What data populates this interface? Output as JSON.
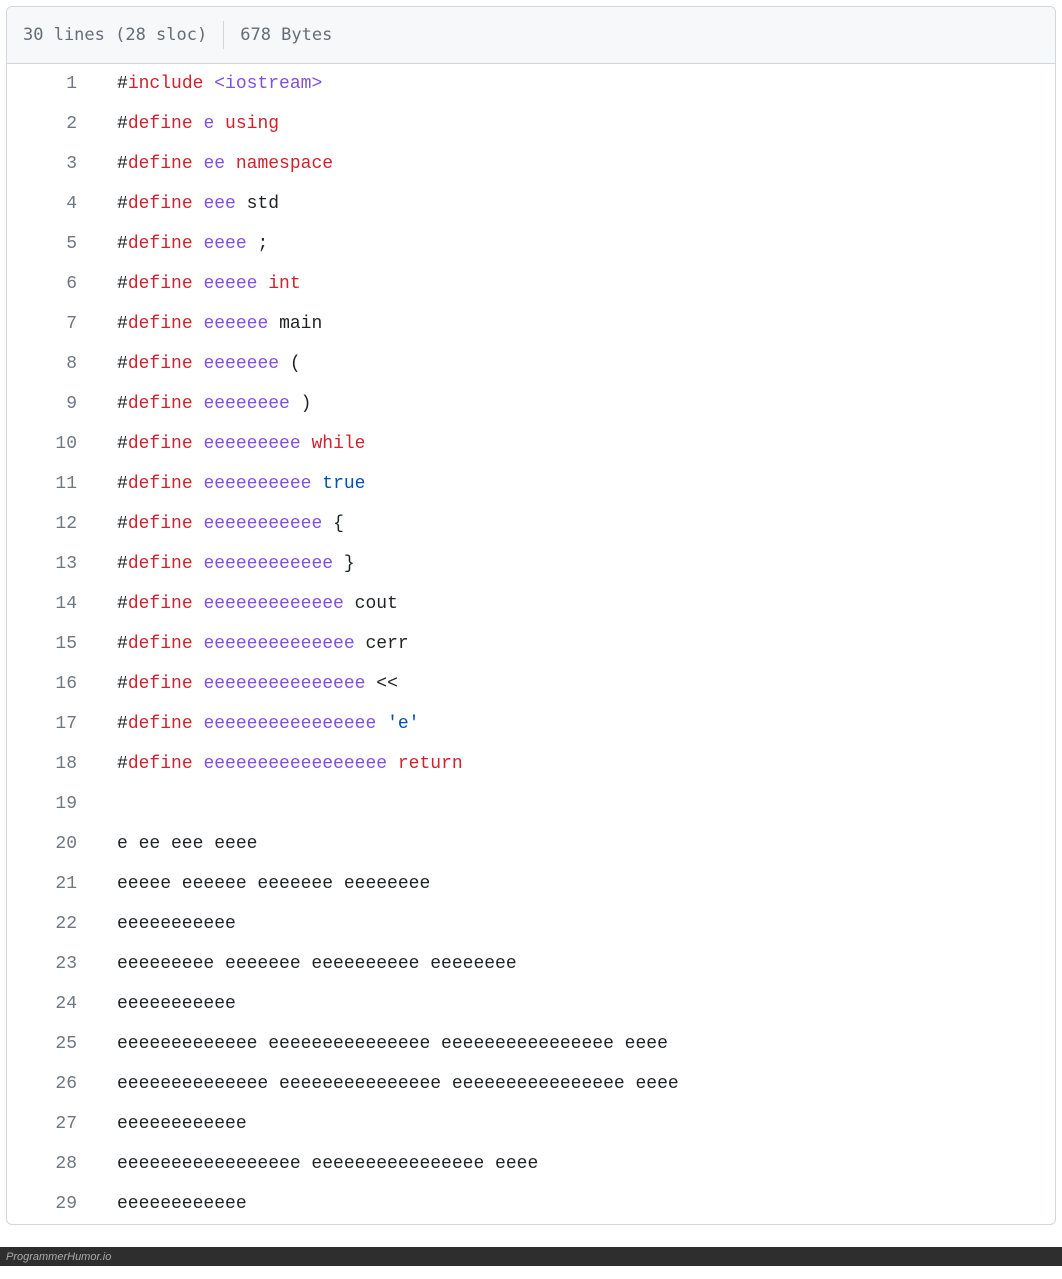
{
  "header": {
    "lines_text": "30 lines (28 sloc)",
    "size_text": "678 Bytes"
  },
  "code": {
    "lines": [
      {
        "n": 1,
        "tokens": [
          {
            "t": "#"
          },
          {
            "t": "include",
            "c": "k-red"
          },
          {
            "t": " "
          },
          {
            "t": "<iostream>",
            "c": "k-purple"
          }
        ]
      },
      {
        "n": 2,
        "tokens": [
          {
            "t": "#"
          },
          {
            "t": "define",
            "c": "k-red"
          },
          {
            "t": " "
          },
          {
            "t": "e ",
            "c": "k-purple"
          },
          {
            "t": "using",
            "c": "k-red"
          }
        ]
      },
      {
        "n": 3,
        "tokens": [
          {
            "t": "#"
          },
          {
            "t": "define",
            "c": "k-red"
          },
          {
            "t": " "
          },
          {
            "t": "ee ",
            "c": "k-purple"
          },
          {
            "t": "namespace",
            "c": "k-red"
          }
        ]
      },
      {
        "n": 4,
        "tokens": [
          {
            "t": "#"
          },
          {
            "t": "define",
            "c": "k-red"
          },
          {
            "t": " "
          },
          {
            "t": "eee ",
            "c": "k-purple"
          },
          {
            "t": "std"
          }
        ]
      },
      {
        "n": 5,
        "tokens": [
          {
            "t": "#"
          },
          {
            "t": "define",
            "c": "k-red"
          },
          {
            "t": " "
          },
          {
            "t": "eeee ",
            "c": "k-purple"
          },
          {
            "t": ";"
          }
        ]
      },
      {
        "n": 6,
        "tokens": [
          {
            "t": "#"
          },
          {
            "t": "define",
            "c": "k-red"
          },
          {
            "t": " "
          },
          {
            "t": "eeeee ",
            "c": "k-purple"
          },
          {
            "t": "int",
            "c": "k-red"
          }
        ]
      },
      {
        "n": 7,
        "tokens": [
          {
            "t": "#"
          },
          {
            "t": "define",
            "c": "k-red"
          },
          {
            "t": " "
          },
          {
            "t": "eeeeee ",
            "c": "k-purple"
          },
          {
            "t": "main"
          }
        ]
      },
      {
        "n": 8,
        "tokens": [
          {
            "t": "#"
          },
          {
            "t": "define",
            "c": "k-red"
          },
          {
            "t": " "
          },
          {
            "t": "eeeeeee ",
            "c": "k-purple"
          },
          {
            "t": "("
          }
        ]
      },
      {
        "n": 9,
        "tokens": [
          {
            "t": "#"
          },
          {
            "t": "define",
            "c": "k-red"
          },
          {
            "t": " "
          },
          {
            "t": "eeeeeeee ",
            "c": "k-purple"
          },
          {
            "t": ")"
          }
        ]
      },
      {
        "n": 10,
        "tokens": [
          {
            "t": "#"
          },
          {
            "t": "define",
            "c": "k-red"
          },
          {
            "t": " "
          },
          {
            "t": "eeeeeeeee ",
            "c": "k-purple"
          },
          {
            "t": "while",
            "c": "k-red"
          }
        ]
      },
      {
        "n": 11,
        "tokens": [
          {
            "t": "#"
          },
          {
            "t": "define",
            "c": "k-red"
          },
          {
            "t": " "
          },
          {
            "t": "eeeeeeeeee ",
            "c": "k-purple"
          },
          {
            "t": "true",
            "c": "k-blue"
          }
        ]
      },
      {
        "n": 12,
        "tokens": [
          {
            "t": "#"
          },
          {
            "t": "define",
            "c": "k-red"
          },
          {
            "t": " "
          },
          {
            "t": "eeeeeeeeeee ",
            "c": "k-purple"
          },
          {
            "t": "{"
          }
        ]
      },
      {
        "n": 13,
        "tokens": [
          {
            "t": "#"
          },
          {
            "t": "define",
            "c": "k-red"
          },
          {
            "t": " "
          },
          {
            "t": "eeeeeeeeeeee ",
            "c": "k-purple"
          },
          {
            "t": "}"
          }
        ]
      },
      {
        "n": 14,
        "tokens": [
          {
            "t": "#"
          },
          {
            "t": "define",
            "c": "k-red"
          },
          {
            "t": " "
          },
          {
            "t": "eeeeeeeeeeeee ",
            "c": "k-purple"
          },
          {
            "t": "cout"
          }
        ]
      },
      {
        "n": 15,
        "tokens": [
          {
            "t": "#"
          },
          {
            "t": "define",
            "c": "k-red"
          },
          {
            "t": " "
          },
          {
            "t": "eeeeeeeeeeeeee ",
            "c": "k-purple"
          },
          {
            "t": "cerr"
          }
        ]
      },
      {
        "n": 16,
        "tokens": [
          {
            "t": "#"
          },
          {
            "t": "define",
            "c": "k-red"
          },
          {
            "t": " "
          },
          {
            "t": "eeeeeeeeeeeeeee ",
            "c": "k-purple"
          },
          {
            "t": "<<"
          }
        ]
      },
      {
        "n": 17,
        "tokens": [
          {
            "t": "#"
          },
          {
            "t": "define",
            "c": "k-red"
          },
          {
            "t": " "
          },
          {
            "t": "eeeeeeeeeeeeeeee ",
            "c": "k-purple"
          },
          {
            "t": "'e'",
            "c": "k-blue"
          }
        ]
      },
      {
        "n": 18,
        "tokens": [
          {
            "t": "#"
          },
          {
            "t": "define",
            "c": "k-red"
          },
          {
            "t": " "
          },
          {
            "t": "eeeeeeeeeeeeeeeee ",
            "c": "k-purple"
          },
          {
            "t": "return",
            "c": "k-red"
          }
        ]
      },
      {
        "n": 19,
        "tokens": []
      },
      {
        "n": 20,
        "tokens": [
          {
            "t": "e ee eee eeee"
          }
        ]
      },
      {
        "n": 21,
        "tokens": [
          {
            "t": "eeeee eeeeee eeeeeee eeeeeeee"
          }
        ]
      },
      {
        "n": 22,
        "tokens": [
          {
            "t": "eeeeeeeeeee"
          }
        ]
      },
      {
        "n": 23,
        "tokens": [
          {
            "t": "eeeeeeeee eeeeeee eeeeeeeeee eeeeeeee"
          }
        ]
      },
      {
        "n": 24,
        "tokens": [
          {
            "t": "eeeeeeeeeee"
          }
        ]
      },
      {
        "n": 25,
        "tokens": [
          {
            "t": "eeeeeeeeeeeee eeeeeeeeeeeeeee eeeeeeeeeeeeeeee eeee"
          }
        ]
      },
      {
        "n": 26,
        "tokens": [
          {
            "t": "eeeeeeeeeeeeee eeeeeeeeeeeeeee eeeeeeeeeeeeeeee eeee"
          }
        ]
      },
      {
        "n": 27,
        "tokens": [
          {
            "t": "eeeeeeeeeeee"
          }
        ]
      },
      {
        "n": 28,
        "tokens": [
          {
            "t": "eeeeeeeeeeeeeeeee eeeeeeeeeeeeeeee eeee"
          }
        ]
      },
      {
        "n": 29,
        "tokens": [
          {
            "t": "eeeeeeeeeeee"
          }
        ]
      }
    ]
  },
  "footer": {
    "watermark": "ProgrammerHumor.io"
  }
}
